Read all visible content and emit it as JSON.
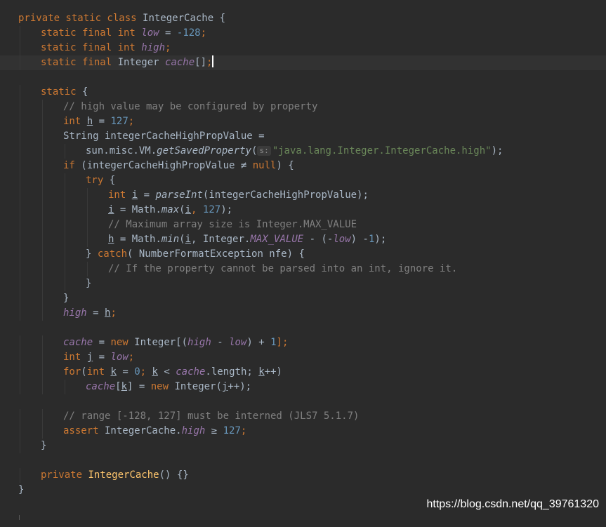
{
  "code": {
    "l1": [
      "private static class",
      "IntegerCache {"
    ],
    "l2": [
      "static final int",
      "low",
      " = ",
      "-128",
      ";"
    ],
    "l3": [
      "static final int",
      "high",
      ";"
    ],
    "l4": [
      "static final",
      " Integer ",
      "cache",
      "[]",
      ";"
    ],
    "l6": [
      "static",
      " {"
    ],
    "l7": "// high value may be configured by property",
    "l8": [
      "int",
      "h",
      " = ",
      "127",
      ";"
    ],
    "l9": "String integerCacheHighPropValue =",
    "l10": [
      "sun.misc.VM.",
      "getSavedProperty",
      "(",
      "s:",
      "\"java.lang.Integer.IntegerCache.high\"",
      ");"
    ],
    "l11": [
      "if",
      " (integerCacheHighPropValue ≠ ",
      "null",
      ") {"
    ],
    "l12": [
      "try",
      " {"
    ],
    "l13": [
      "int",
      "i",
      " = ",
      "parseInt",
      "(integerCacheHighPropValue);"
    ],
    "l14": [
      "i",
      " = Math.",
      "max",
      "(",
      "i",
      ", ",
      "127",
      ");"
    ],
    "l15": "// Maximum array size is Integer.MAX_VALUE",
    "l16": [
      "h",
      " = Math.",
      "min",
      "(",
      "i",
      ", Integer.",
      "MAX_VALUE",
      " - (-",
      "low",
      ") -",
      "1",
      ");"
    ],
    "l17": [
      "} ",
      "catch",
      "( NumberFormatException nfe) {"
    ],
    "l18": "// If the property cannot be parsed into an int, ignore it.",
    "l19": "}",
    "l20": "}",
    "l21": [
      "high",
      " = ",
      "h",
      ";"
    ],
    "l23": [
      "cache",
      " = ",
      "new",
      " Integer[(",
      "high",
      " - ",
      "low",
      ") + ",
      "1",
      "];"
    ],
    "l24": [
      "int",
      "j",
      " = ",
      "low",
      ";"
    ],
    "l25": [
      "for",
      "(",
      "int",
      "k",
      " = ",
      "0",
      "; ",
      "k",
      " < ",
      "cache",
      ".length; ",
      "k",
      "++)"
    ],
    "l26": [
      "cache",
      "[",
      "k",
      "] = ",
      "new",
      " Integer(",
      "j",
      "++);"
    ],
    "l28": "// range [-128, 127] must be interned (JLS7 5.1.7)",
    "l29": [
      "assert",
      " IntegerCache.",
      "high",
      " ≥ ",
      "127",
      ";"
    ],
    "l30": "}",
    "l32": [
      "private",
      "IntegerCache",
      "() {}"
    ],
    "l33": "}"
  },
  "watermark": "https://blog.csdn.net/qq_39761320",
  "colors": {
    "background": "#2b2b2b",
    "current_line": "#323232",
    "keyword": "#cc7832",
    "number": "#6897bb",
    "string": "#6a8759",
    "comment": "#808080",
    "field": "#9876aa",
    "declaration": "#ffc66d",
    "text": "#a9b7c6"
  }
}
